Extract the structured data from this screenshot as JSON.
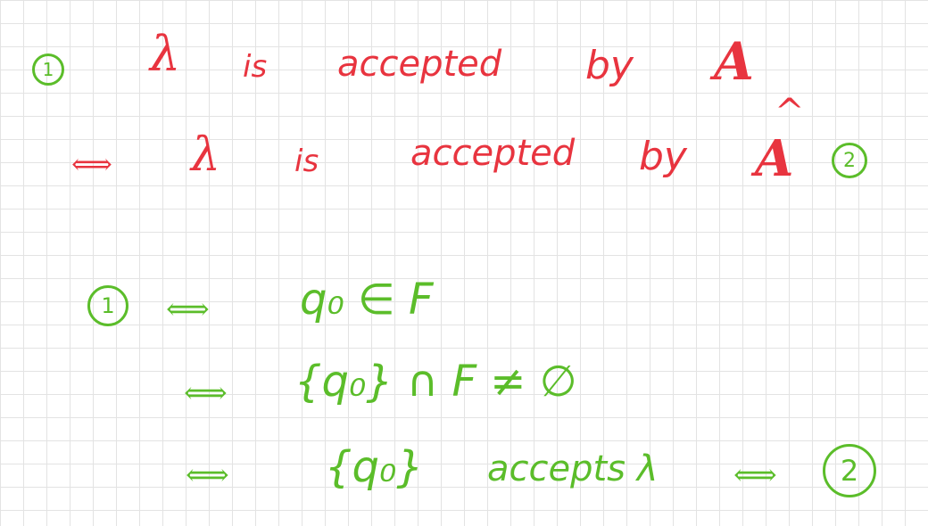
{
  "line1": {
    "marker": "1",
    "lambda": "λ",
    "w1": "is",
    "w2": "accepted",
    "w3": "by",
    "automaton": "A"
  },
  "line2": {
    "iff": "⟺",
    "lambda": "λ",
    "w1": "is",
    "w2": "accepted",
    "w3": "by",
    "automaton": "A",
    "hat": "^",
    "marker": "2"
  },
  "proof": {
    "marker": "1",
    "iff1": "⟺",
    "expr1": "q₀ ∈ F",
    "iff2": "⟺",
    "expr2": "{q₀} ∩ F ≠ ∅",
    "iff3": "⟺",
    "expr3a": "{q₀}",
    "expr3b": "accepts λ",
    "iff4": "⟺",
    "end_marker": "2"
  },
  "colors": {
    "red_ink": "#e8343f",
    "green_ink": "#5bbd2a",
    "grid": "#e3e3e3"
  }
}
